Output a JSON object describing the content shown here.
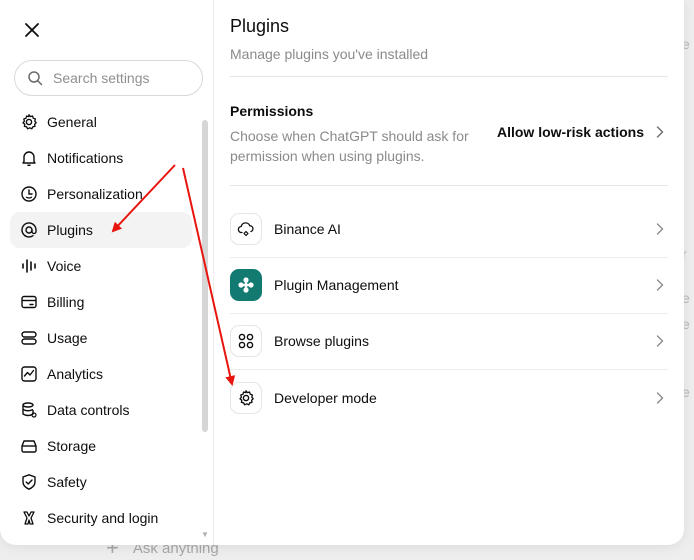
{
  "background": {
    "composer_placeholder": "Ask anything"
  },
  "sidebar": {
    "search_placeholder": "Search settings",
    "items": [
      {
        "label": "General",
        "icon": "gear-icon"
      },
      {
        "label": "Notifications",
        "icon": "bell-icon"
      },
      {
        "label": "Personalization",
        "icon": "personalization-icon"
      },
      {
        "label": "Plugins",
        "icon": "at-icon",
        "active": true
      },
      {
        "label": "Voice",
        "icon": "waveform-icon"
      },
      {
        "label": "Billing",
        "icon": "card-icon"
      },
      {
        "label": "Usage",
        "icon": "usage-icon"
      },
      {
        "label": "Analytics",
        "icon": "chart-icon"
      },
      {
        "label": "Data controls",
        "icon": "database-icon"
      },
      {
        "label": "Storage",
        "icon": "storage-icon"
      },
      {
        "label": "Safety",
        "icon": "shield-icon"
      },
      {
        "label": "Security and login",
        "icon": "security-icon"
      }
    ]
  },
  "main": {
    "title": "Plugins",
    "subtitle": "Manage plugins you've installed",
    "permissions": {
      "title": "Permissions",
      "description": "Choose when ChatGPT should ask for permission when using plugins.",
      "value": "Allow low-risk actions"
    },
    "rows": [
      {
        "label": "Binance AI",
        "icon": "cloud-icon"
      },
      {
        "label": "Plugin Management",
        "icon": "plugin-icon"
      },
      {
        "label": "Browse plugins",
        "icon": "grid-icon"
      },
      {
        "label": "Developer mode",
        "icon": "gear-icon"
      }
    ]
  },
  "colors": {
    "accent_teal": "#127a71",
    "annotation_red": "#e8150f",
    "active_bg": "#f3f3f3"
  }
}
